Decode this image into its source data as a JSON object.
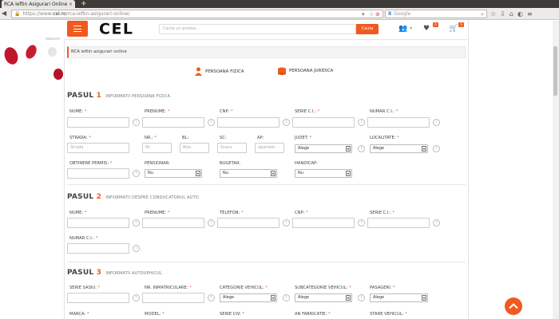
{
  "browser": {
    "tab_title": "RCA Ieftin Asigurari Online",
    "url_prefix": "https://www.",
    "url_host": "cel.ro",
    "url_path": "/rca-ieftin-asigurari-online/",
    "search_placeholder": "Google",
    "search_engine_icon": "google-icon"
  },
  "header": {
    "logo_text": "CEL",
    "search_placeholder": "Cauta un produs...",
    "search_button": "Cauta",
    "wishlist_count": "0",
    "cart_count": "0",
    "accent_color": "#f05a1f"
  },
  "side_tag": "reducere",
  "breadcrumb": "RCA ieftin asigurari online",
  "person_types": [
    "PERSOANA FIZICA",
    "PERSOANA JURIDICA"
  ],
  "step1": {
    "prefix": "PASUL",
    "num": "1",
    "subtitle": "INFORMATII PERSOANA FIZICA",
    "row1": [
      "NUME:",
      "PRENUME:",
      "CNP:",
      "SERIE C.I.:",
      "NUMAR C.I.:"
    ],
    "row2_labels": [
      "STRADA:",
      "NR.:",
      "BL:",
      "SC:",
      "AP:",
      "JUDET:",
      "LOCALITATE:"
    ],
    "row2_placeholders": [
      "Strada",
      "Nr.",
      "Bloc",
      "Scara",
      "apartam."
    ],
    "row2_selects": [
      "Alege",
      "Alege"
    ],
    "row3_labels": [
      "OBTINERE PERMIS:",
      "PENSIONAR:",
      "BUGETAR:",
      "HANDICAP:"
    ],
    "row3_selects": [
      "Nu",
      "Nu",
      "Nu"
    ]
  },
  "step2": {
    "prefix": "PASUL",
    "num": "2",
    "subtitle": "INFORMATII DESPRE CONDUCATORUL AUTO",
    "row1": [
      "NUME:",
      "PRENUME:",
      "TELEFON:",
      "CNP:",
      "SERIE C.I.:"
    ],
    "row2": [
      "NUMAR C.I.:"
    ]
  },
  "step3": {
    "prefix": "PASUL",
    "num": "3",
    "subtitle": "INFORMATII AUTOVEHICUL",
    "row1": [
      "SERIE SASIU:",
      "NR. INMATRICULARE:",
      "CATEGORIE VEHICUL:",
      "SUBCATEGORIE VEHICUL:",
      "PASAGERI:"
    ],
    "row1_selects": [
      "Alege",
      "Alege",
      "Alege"
    ],
    "row2": [
      "MARCA:",
      "MODEL:",
      "SERIE CIV:",
      "AN FABRICATIE:",
      "STARE VEHICUL:"
    ]
  },
  "info_glyph": "i",
  "required_mark": "*"
}
